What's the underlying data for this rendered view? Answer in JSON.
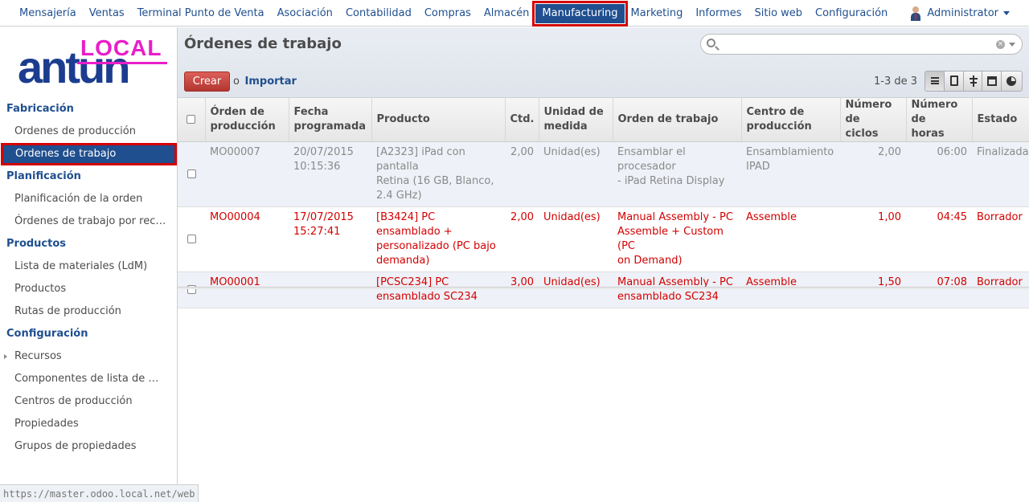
{
  "topmenu": {
    "items": [
      {
        "label": "Mensajería"
      },
      {
        "label": "Ventas"
      },
      {
        "label": "Terminal Punto de Venta"
      },
      {
        "label": "Asociación"
      },
      {
        "label": "Contabilidad"
      },
      {
        "label": "Compras"
      },
      {
        "label": "Almacén"
      },
      {
        "label": "Manufacturing",
        "active": true
      },
      {
        "label": "Marketing"
      },
      {
        "label": "Informes"
      },
      {
        "label": "Sitio web"
      },
      {
        "label": "Configuración"
      }
    ],
    "user": "Administrator"
  },
  "logo": {
    "badge": "LOCAL",
    "name": "antun"
  },
  "sidebar": {
    "sections": [
      {
        "title": "Fabricación",
        "links": [
          {
            "label": "Ordenes de producción"
          },
          {
            "label": "Ordenes de trabajo",
            "active": true
          }
        ]
      },
      {
        "title": "Planificación",
        "links": [
          {
            "label": "Planificación de la orden"
          },
          {
            "label": "Órdenes de trabajo por rec…"
          }
        ]
      },
      {
        "title": "Productos",
        "links": [
          {
            "label": "Lista de materiales (LdM)"
          },
          {
            "label": "Productos"
          },
          {
            "label": "Rutas de producción"
          }
        ]
      },
      {
        "title": "Configuración",
        "links": [
          {
            "label": "Recursos",
            "expandable": true
          },
          {
            "label": "Componentes de lista de …"
          },
          {
            "label": "Centros de producción"
          },
          {
            "label": "Propiedades"
          },
          {
            "label": "Grupos de propiedades"
          }
        ]
      }
    ]
  },
  "status_url": "https://master.odoo.local.net/web",
  "view": {
    "title": "Órdenes de trabajo",
    "search_value": "",
    "create_label": "Crear",
    "or_label": "o",
    "import_label": "Importar",
    "pager": "1-3 de 3",
    "view_icons": [
      "list-icon",
      "form-icon",
      "gantt-icon",
      "calendar-icon",
      "graph-icon"
    ]
  },
  "table": {
    "columns": [
      {
        "l1": "Órden de",
        "l2": "producción"
      },
      {
        "l1": "Fecha",
        "l2": "programada"
      },
      {
        "l1": "Producto",
        "l2": ""
      },
      {
        "l1": "Ctd.",
        "l2": ""
      },
      {
        "l1": "Unidad de",
        "l2": "medida"
      },
      {
        "l1": "Orden de trabajo",
        "l2": ""
      },
      {
        "l1": "Centro de",
        "l2": "producción"
      },
      {
        "l1": "Número de",
        "l2": "ciclos"
      },
      {
        "l1": "Número de",
        "l2": "horas"
      },
      {
        "l1": "Estado",
        "l2": ""
      }
    ],
    "rows": [
      {
        "state_class": "done",
        "order": "MO00007",
        "date": [
          "20/07/2015",
          "10:15:36"
        ],
        "product": [
          "[A2323] iPad con pantalla",
          "Retina (16 GB, Blanco,",
          "2.4 GHz)"
        ],
        "qty": "2,00",
        "uom": "Unidad(es)",
        "workorder": [
          "Ensamblar el procesador",
          "- iPad Retina Display"
        ],
        "workcenter": [
          "Ensamblamiento",
          "IPAD"
        ],
        "cycles": "2,00",
        "hours": "06:00",
        "state": "Finalizada"
      },
      {
        "state_class": "draft",
        "order": "MO00004",
        "date": [
          "17/07/2015",
          "15:27:41"
        ],
        "product": [
          "[B3424] PC ensamblado +",
          "personalizado (PC bajo",
          "demanda)"
        ],
        "qty": "2,00",
        "uom": "Unidad(es)",
        "workorder": [
          "Manual Assembly - PC",
          "Assemble + Custom (PC",
          "on Demand)"
        ],
        "workcenter": [
          "Assemble"
        ],
        "cycles": "1,00",
        "hours": "04:45",
        "state": "Borrador"
      },
      {
        "state_class": "draft alt",
        "order": "MO00001",
        "date": [],
        "product": [
          "[PCSC234] PC",
          "ensamblado SC234"
        ],
        "qty": "3,00",
        "uom": "Unidad(es)",
        "workorder": [
          "Manual Assembly - PC",
          "ensamblado SC234"
        ],
        "workcenter": [
          "Assemble"
        ],
        "cycles": "1,50",
        "hours": "07:08",
        "state": "Borrador"
      }
    ]
  },
  "colors": {
    "brand": "#1f4f8f",
    "create": "#c9403a",
    "draft": "#d40000",
    "logo_badge": "#e91ec9",
    "logo": "#1c3d8f"
  }
}
